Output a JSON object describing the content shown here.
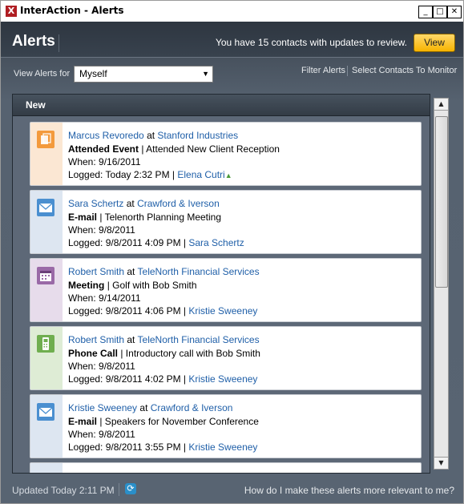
{
  "window": {
    "title": "InterAction - Alerts",
    "controls": {
      "minimize": "_",
      "maximize": "□",
      "close": "✕"
    }
  },
  "header": {
    "title": "Alerts",
    "message": "You have 15 contacts with updates to review.",
    "view_button": "View"
  },
  "toolbar": {
    "view_alerts_for_label": "View Alerts for",
    "view_alerts_for_value": "Myself",
    "filter_alerts": "Filter Alerts",
    "select_contacts": "Select Contacts To Monitor"
  },
  "section": {
    "title": "New"
  },
  "alerts": [
    {
      "icon": "event-icon",
      "contact": "Marcus Revoredo",
      "at": "at",
      "company": "Stanford Industries",
      "type": "Attended Event",
      "subject": "| Attended New Client Reception",
      "when_label": "When:",
      "when": "9/16/2011",
      "logged_label": "Logged:",
      "logged": "Today 2:32 PM |",
      "by": "Elena Cutri",
      "band_color": "#fbe7d3",
      "icon_color": "#f39a3c"
    },
    {
      "icon": "email-icon",
      "contact": "Sara Schertz",
      "at": "at",
      "company": "Crawford & Iverson",
      "type": "E-mail",
      "subject": "| Telenorth Planning Meeting",
      "when_label": "When:",
      "when": "9/8/2011",
      "logged_label": "Logged:",
      "logged": "9/8/2011 4:09 PM |",
      "by": "Sara Schertz",
      "band_color": "#dde6f1",
      "icon_color": "#4a8fd0"
    },
    {
      "icon": "calendar-icon",
      "contact": "Robert Smith",
      "at": "at",
      "company": "TeleNorth Financial Services",
      "type": "Meeting",
      "subject": "| Golf with Bob Smith",
      "when_label": "When:",
      "when": "9/14/2011",
      "logged_label": "Logged:",
      "logged": "9/8/2011 4:06 PM |",
      "by": "Kristie Sweeney",
      "band_color": "#e7dceb",
      "icon_color": "#9a6aa7"
    },
    {
      "icon": "phone-icon",
      "contact": "Robert Smith",
      "at": "at",
      "company": "TeleNorth Financial Services",
      "type": "Phone Call",
      "subject": "| Introductory call with Bob Smith",
      "when_label": "When:",
      "when": "9/8/2011",
      "logged_label": "Logged:",
      "logged": "9/8/2011 4:02 PM |",
      "by": "Kristie Sweeney",
      "band_color": "#deecd5",
      "icon_color": "#6fae4f"
    },
    {
      "icon": "email-icon",
      "contact": "Kristie Sweeney",
      "at": "at",
      "company": "Crawford & Iverson",
      "type": "E-mail",
      "subject": "| Speakers for November Conference",
      "when_label": "When:",
      "when": "9/8/2011",
      "logged_label": "Logged:",
      "logged": "9/8/2011 3:55 PM |",
      "by": "Kristie Sweeney",
      "band_color": "#dde6f1",
      "icon_color": "#4a8fd0"
    }
  ],
  "footer": {
    "updated": "Updated Today 2:11 PM",
    "help": "How do I make these alerts more relevant to me?"
  }
}
